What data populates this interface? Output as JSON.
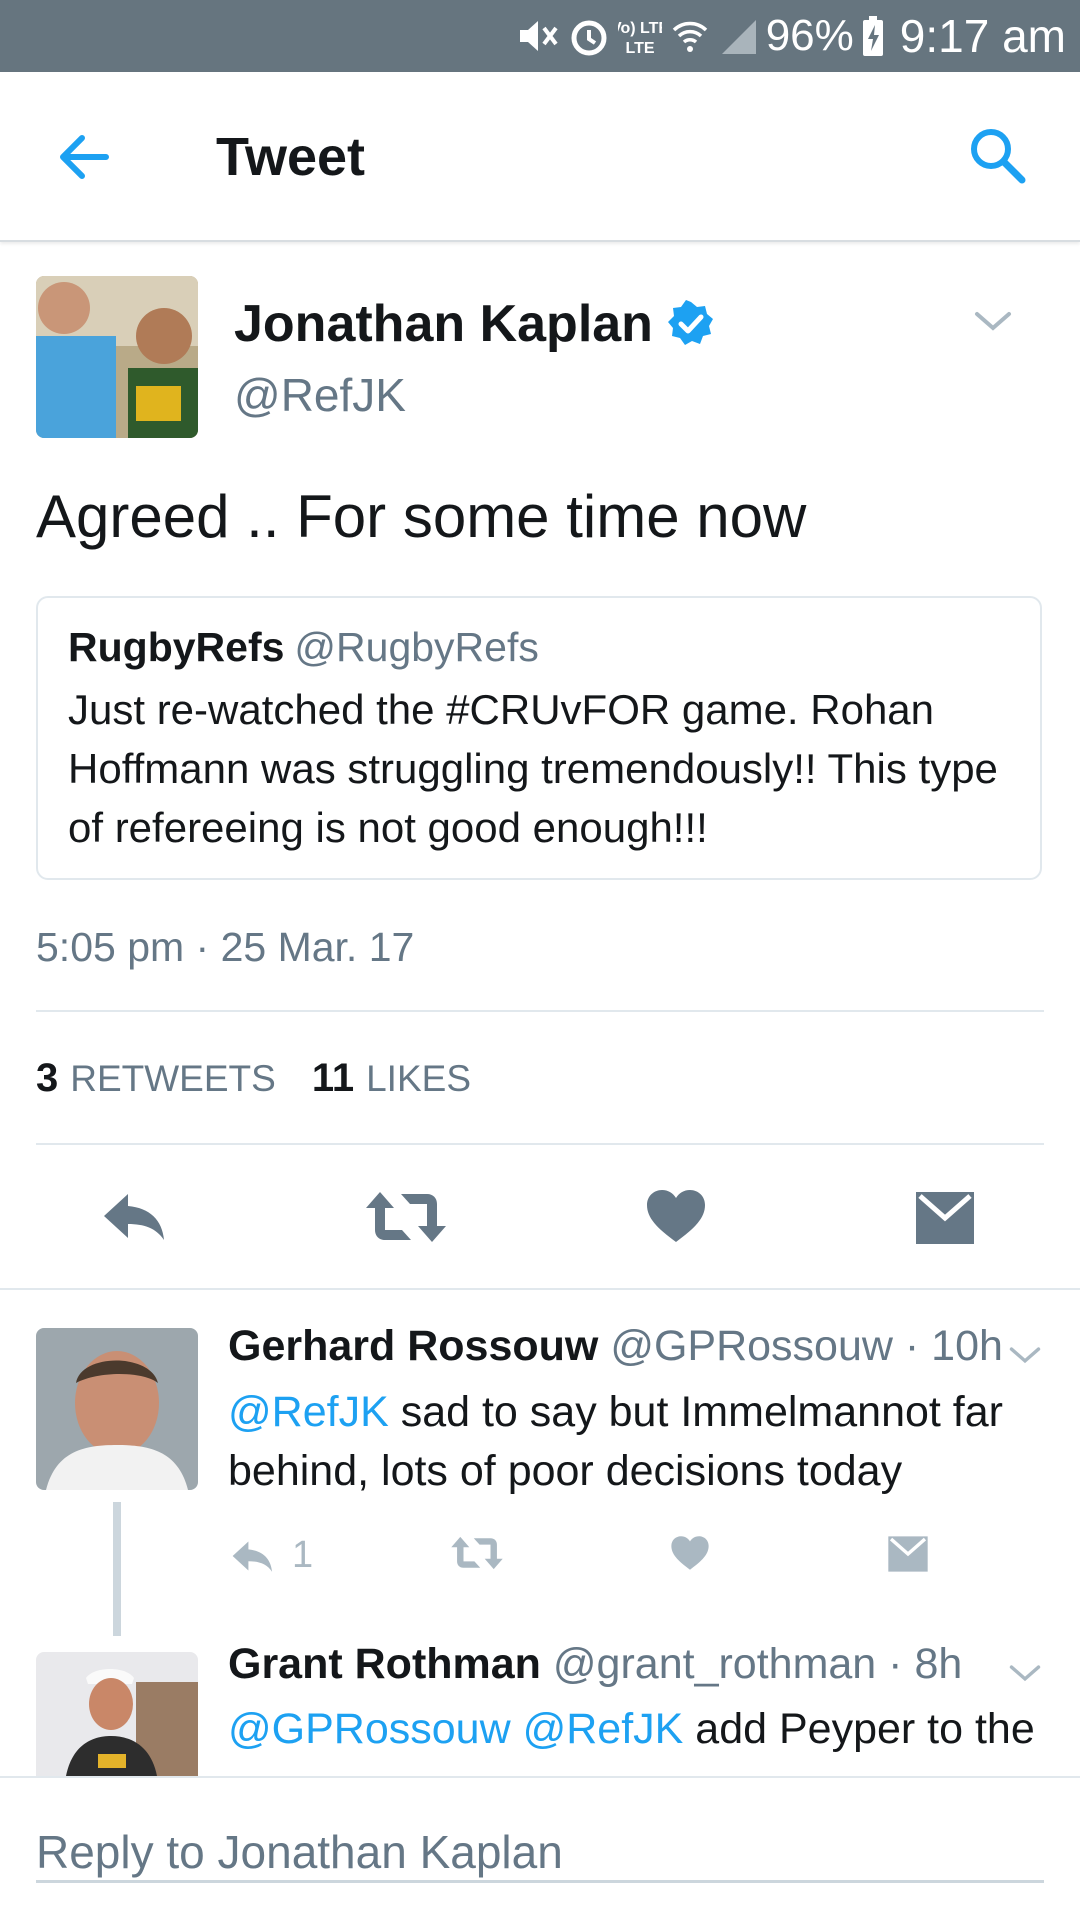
{
  "status_bar": {
    "battery": "96%",
    "time": "9:17 am",
    "icons": [
      "mute-icon",
      "alarm-icon",
      "volte-icon",
      "wifi-icon",
      "signal-icon",
      "battery-charging-icon"
    ],
    "volte_label": "Vo) LTE"
  },
  "header": {
    "title": "Tweet",
    "back_icon": "back-arrow-icon",
    "search_icon": "search-icon"
  },
  "tweet": {
    "author_name": "Jonathan Kaplan",
    "author_handle": "@RefJK",
    "verified": true,
    "text": "Agreed .. For some time now",
    "quoted": {
      "name": "RugbyRefs",
      "handle": "@RugbyRefs",
      "text": "Just re-watched the #CRUvFOR game. Rohan Hoffmann was struggling tremendously!! This type of refereeing is not good enough!!!"
    },
    "timestamp": "5:05 pm · 25 Mar. 17",
    "retweets_count": "3",
    "retweets_label": "RETWEETS",
    "likes_count": "11",
    "likes_label": "LIKES"
  },
  "replies": [
    {
      "name": "Gerhard Rossouw",
      "meta": "@GPRossouw · 10h",
      "mention": "@RefJK",
      "text_line1": " sad to say but Immelmannot far",
      "text_line2": "behind, lots of poor decisions today",
      "reply_count": "1"
    },
    {
      "name": "Grant Rothman",
      "meta": "@grant_rothman · 8h",
      "mention1": "@GPRossouw",
      "mention2": "@RefJK",
      "text_line1": " add Peyper to the"
    }
  ],
  "compose": {
    "placeholder": "Reply to Jonathan Kaplan"
  },
  "colors": {
    "accent": "#1da1f2",
    "status_bar": "#66757f",
    "action_icon": "#657786"
  }
}
